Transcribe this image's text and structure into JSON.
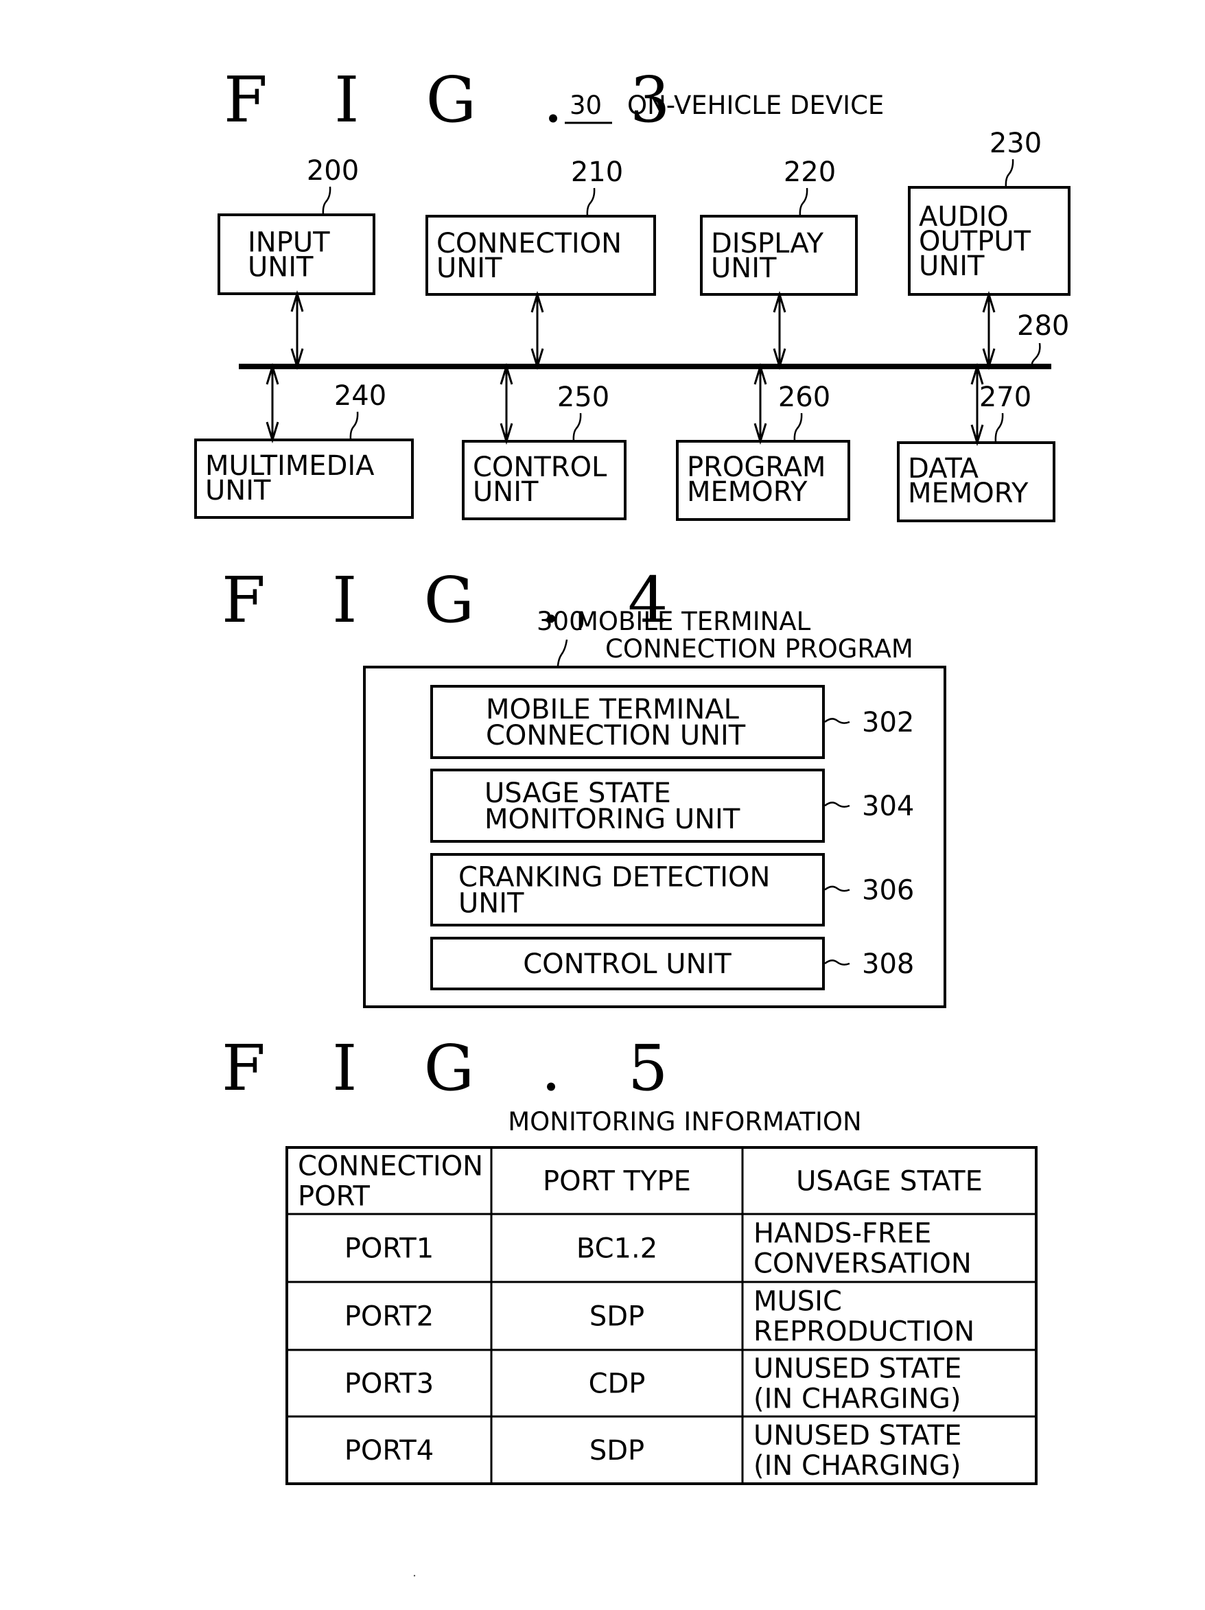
{
  "fig3": {
    "figure_label": "F I G . 3",
    "device_ref": "30",
    "device_name": "ON-VEHICLE DEVICE",
    "bus_ref": "280",
    "top_units": [
      {
        "ref": "200",
        "lines": [
          "INPUT",
          "UNIT"
        ]
      },
      {
        "ref": "210",
        "lines": [
          "CONNECTION",
          "UNIT"
        ]
      },
      {
        "ref": "220",
        "lines": [
          "DISPLAY",
          "UNIT"
        ]
      },
      {
        "ref": "230",
        "lines": [
          "AUDIO",
          "OUTPUT",
          "UNIT"
        ]
      }
    ],
    "bottom_units": [
      {
        "ref": "240",
        "lines": [
          "MULTIMEDIA",
          "UNIT"
        ]
      },
      {
        "ref": "250",
        "lines": [
          "CONTROL",
          "UNIT"
        ]
      },
      {
        "ref": "260",
        "lines": [
          "PROGRAM",
          "MEMORY"
        ]
      },
      {
        "ref": "270",
        "lines": [
          "DATA",
          "MEMORY"
        ]
      }
    ]
  },
  "fig4": {
    "figure_label": "F I G . 4",
    "program_ref": "300",
    "program_name_lines": [
      "MOBILE TERMINAL",
      "CONNECTION PROGRAM"
    ],
    "modules": [
      {
        "ref": "302",
        "lines": [
          "MOBILE TERMINAL",
          "CONNECTION UNIT"
        ]
      },
      {
        "ref": "304",
        "lines": [
          "USAGE STATE",
          "MONITORING UNIT"
        ]
      },
      {
        "ref": "306",
        "lines": [
          "CRANKING DETECTION",
          "UNIT"
        ]
      },
      {
        "ref": "308",
        "lines": [
          "CONTROL UNIT"
        ]
      }
    ]
  },
  "fig5": {
    "figure_label": "F I G . 5",
    "table_title": "MONITORING INFORMATION",
    "columns": [
      {
        "lines": [
          "CONNECTION",
          "PORT"
        ]
      },
      {
        "lines": [
          "PORT TYPE"
        ]
      },
      {
        "lines": [
          "USAGE STATE"
        ]
      }
    ],
    "rows": [
      {
        "port": "PORT1",
        "type": "BC1.2",
        "usage": [
          "HANDS-FREE",
          "CONVERSATION"
        ]
      },
      {
        "port": "PORT2",
        "type": "SDP",
        "usage": [
          "MUSIC",
          "REPRODUCTION"
        ]
      },
      {
        "port": "PORT3",
        "type": "CDP",
        "usage": [
          "UNUSED STATE",
          "(IN CHARGING)"
        ]
      },
      {
        "port": "PORT4",
        "type": "SDP",
        "usage": [
          "UNUSED STATE",
          "(IN CHARGING)"
        ]
      }
    ]
  }
}
